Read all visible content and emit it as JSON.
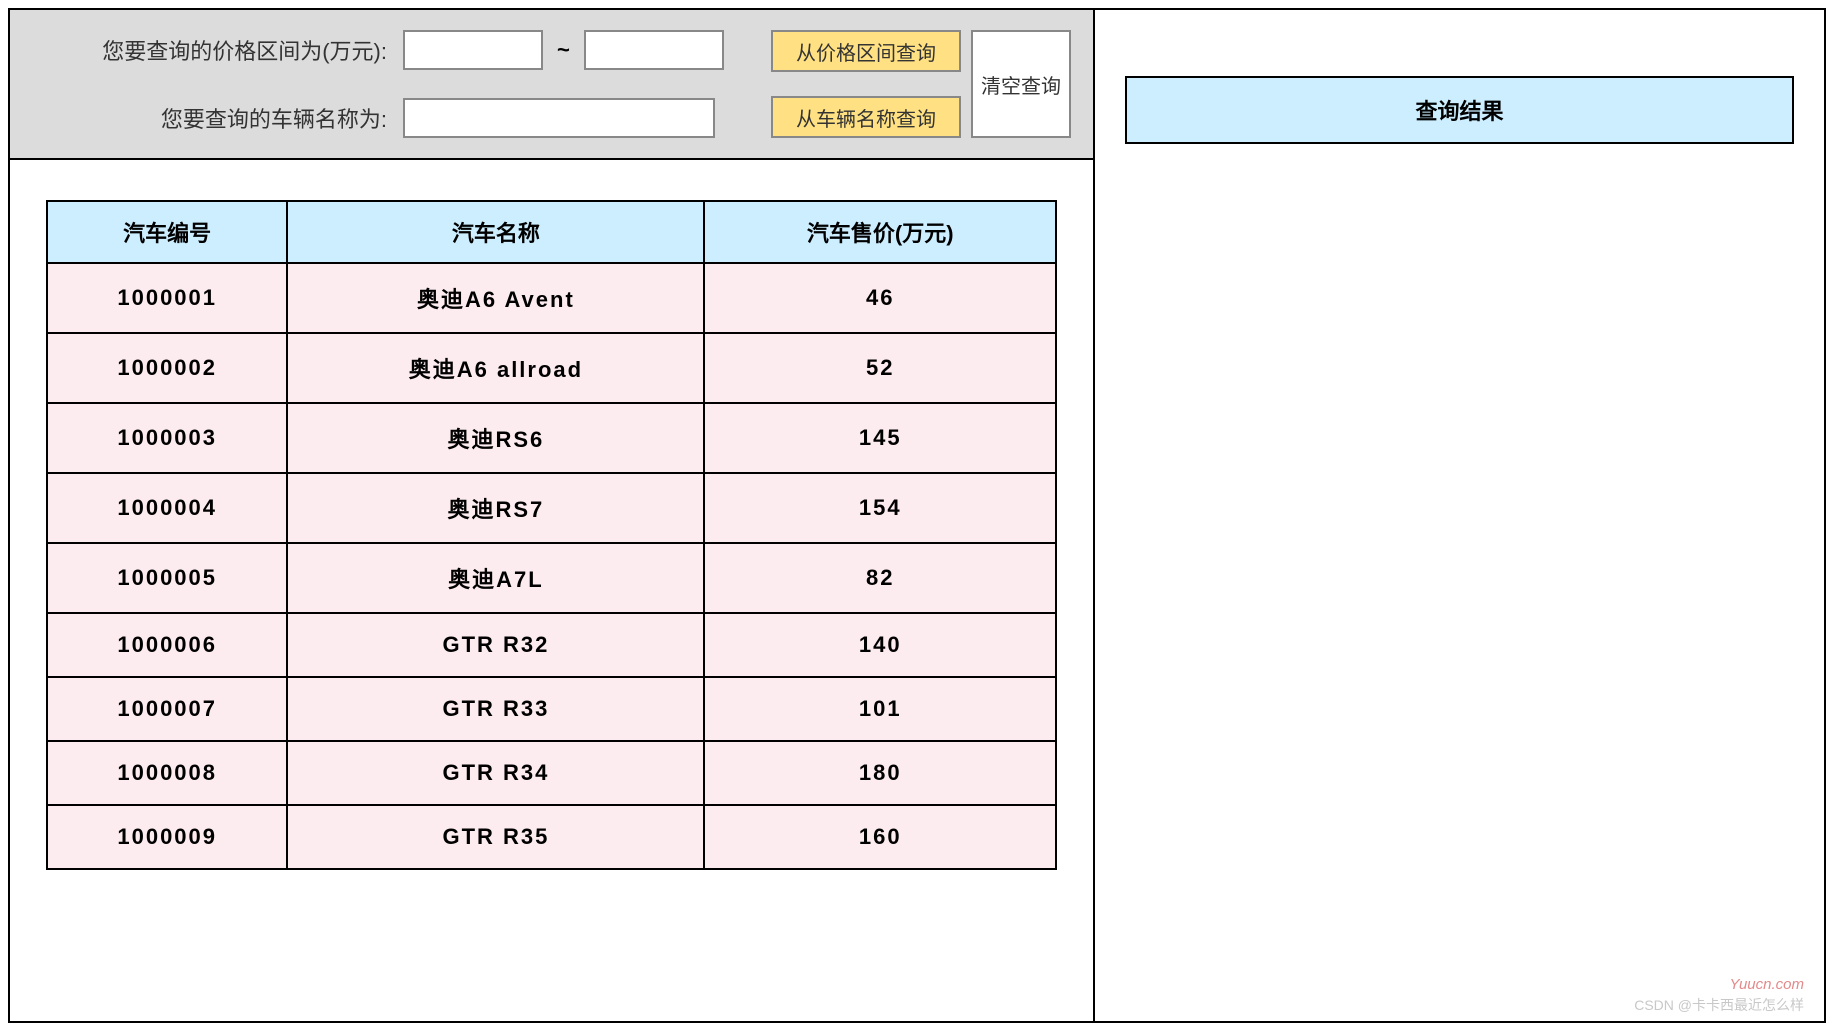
{
  "search": {
    "price_label": "您要查询的价格区间为(万元):",
    "name_label": "您要查询的车辆名称为:",
    "price_from": "",
    "price_to": "",
    "name_value": "",
    "tilde": "~",
    "btn_price": "从价格区间查询",
    "btn_name": "从车辆名称查询",
    "btn_clear": "清空查询"
  },
  "table": {
    "headers": {
      "id": "汽车编号",
      "name": "汽车名称",
      "price": "汽车售价(万元)"
    },
    "rows": [
      {
        "id": "1000001",
        "name": "奥迪A6 Avent",
        "price": "46"
      },
      {
        "id": "1000002",
        "name": "奥迪A6 allroad",
        "price": "52"
      },
      {
        "id": "1000003",
        "name": "奥迪RS6",
        "price": "145"
      },
      {
        "id": "1000004",
        "name": "奥迪RS7",
        "price": "154"
      },
      {
        "id": "1000005",
        "name": "奥迪A7L",
        "price": "82"
      },
      {
        "id": "1000006",
        "name": "GTR R32",
        "price": "140"
      },
      {
        "id": "1000007",
        "name": "GTR R33",
        "price": "101"
      },
      {
        "id": "1000008",
        "name": "GTR R34",
        "price": "180"
      },
      {
        "id": "1000009",
        "name": "GTR R35",
        "price": "160"
      }
    ]
  },
  "result": {
    "title": "查询结果"
  },
  "watermark1": "Yuucn.com",
  "watermark2": "CSDN @卡卡西最近怎么样"
}
